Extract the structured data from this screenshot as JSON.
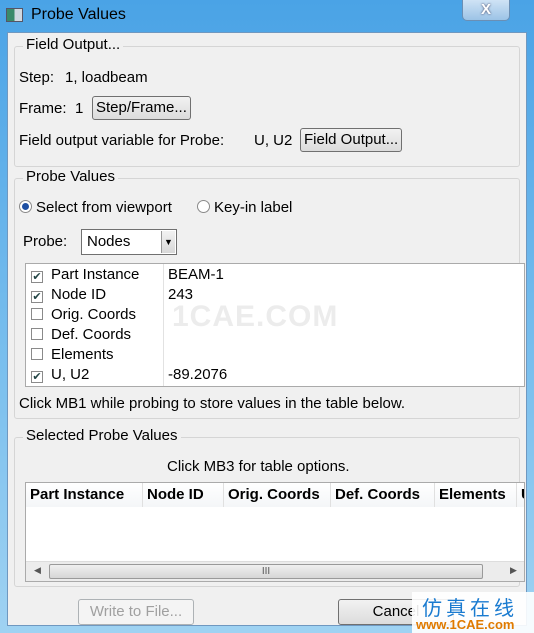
{
  "window": {
    "title": "Probe Values",
    "close_icon": "close-icon",
    "close_label": "X"
  },
  "field_output": {
    "group_label": "Field Output...",
    "step_label": "Step:",
    "step_value": "1, loadbeam",
    "frame_label": "Frame:",
    "frame_value": "1",
    "step_frame_button": "Step/Frame...",
    "variable_label": "Field output variable for Probe:",
    "variable_value": "U, U2",
    "field_output_button": "Field Output..."
  },
  "probe_values": {
    "group_label": "Probe Values",
    "radio_select": "Select from viewport",
    "radio_select_checked": true,
    "radio_keyin": "Key-in label",
    "radio_keyin_checked": false,
    "probe_label": "Probe:",
    "probe_value": "Nodes",
    "items": [
      {
        "label": "Part Instance",
        "checked": true,
        "value": "BEAM-1"
      },
      {
        "label": "Node ID",
        "checked": true,
        "value": "243"
      },
      {
        "label": "Orig. Coords",
        "checked": false,
        "value": ""
      },
      {
        "label": "Def. Coords",
        "checked": false,
        "value": ""
      },
      {
        "label": "Elements",
        "checked": false,
        "value": ""
      },
      {
        "label": "U, U2",
        "checked": true,
        "value": "-89.2076"
      }
    ],
    "hint": "Click MB1 while probing to store values in the table below."
  },
  "selected": {
    "group_label": "Selected Probe Values",
    "hint": "Click MB3 for table options.",
    "columns": [
      "Part Instance",
      "Node ID",
      "Orig. Coords",
      "Def. Coords",
      "Elements",
      "U"
    ],
    "scroll_grip": "III"
  },
  "buttons": {
    "write": "Write to File...",
    "cancel": "Cancel"
  },
  "watermark": {
    "center": "1CAE.COM",
    "logo_cn": "仿真在线",
    "logo_url": "www.1CAE.com"
  }
}
